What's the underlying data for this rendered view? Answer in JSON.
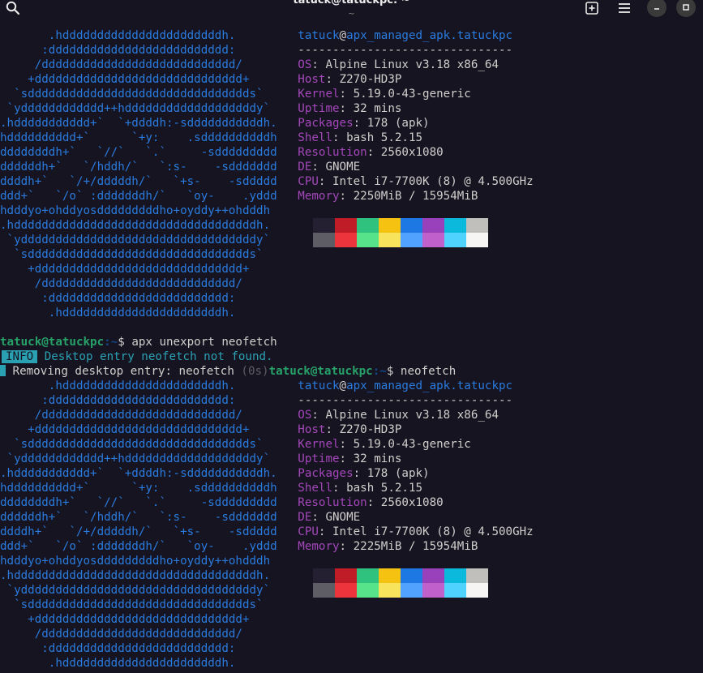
{
  "window": {
    "title": "tatuck@tatuckpc: ~",
    "subtitle": "~"
  },
  "logo_lines": [
    "       .hdddddddddddddddddddddddh.",
    "      :dddddddddddddddddddddddddd:",
    "     /dddddddddddddddddddddddddddd/",
    "    +dddddddddddddddddddddddddddddd+",
    "  `sdddddddddddddddddddddddddddddddds`",
    " `ydddddddddddd++hdddddddddddddddddddy`",
    ".hddddddddddd+`  `+ddddh:-sdddddddddddh.",
    "hdddddddddd+`      `+y:    .sddddddddddh",
    "ddddddddh+`   `//`   `.`     -sddddddddd",
    "ddddddh+`   `/hddh/`   `:s-    -sddddddd",
    "ddddh+`   `/+/dddddh/`   `+s-    -sddddd",
    "ddd+`   `/o` :dddddddh/`   `oy-    .yddd",
    "hdddyo+ohddyosdddddddddho+oyddy++ohdddh",
    ".hdddddddddddddddddddddddddddddddddddh.",
    " `yddddddddddddddddddddddddddddddddddy`",
    "  `sdddddddddddddddddddddddddddddddds`",
    "    +dddddddddddddddddddddddddddddd+",
    "     /dddddddddddddddddddddddddddd/",
    "      :dddddddddddddddddddddddddd:",
    "       .hdddddddddddddddddddddddh."
  ],
  "prompt": {
    "user_host": "tatuck@tatuckpc",
    "path": ":~",
    "symbol": "$"
  },
  "fetch1": {
    "header_user": "tatuck",
    "header_at": "@",
    "header_host": "apx_managed_apk.tatuckpc",
    "separator": "-------------------------------",
    "rows": [
      {
        "key": "OS",
        "value": ": Alpine Linux v3.18 x86_64"
      },
      {
        "key": "Host",
        "value": ": Z270-HD3P"
      },
      {
        "key": "Kernel",
        "value": ": 5.19.0-43-generic"
      },
      {
        "key": "Uptime",
        "value": ": 32 mins"
      },
      {
        "key": "Packages",
        "value": ": 178 (apk)"
      },
      {
        "key": "Shell",
        "value": ": bash 5.2.15"
      },
      {
        "key": "Resolution",
        "value": ": 2560x1080"
      },
      {
        "key": "DE",
        "value": ": GNOME"
      },
      {
        "key": "CPU",
        "value": ": Intel i7-7700K (8) @ 4.500GHz"
      },
      {
        "key": "Memory",
        "value": ": 2250MiB / 15954MiB"
      }
    ]
  },
  "command1": {
    "cmd": "apx unexport neofetch",
    "info_badge": "INFO",
    "info_text": "Desktop entry neofetch not found.",
    "removing_text": "  Removing desktop entry: neofetch ",
    "elapsed": "(0s)"
  },
  "command2": {
    "cmd": "neofetch"
  },
  "fetch2": {
    "header_user": "tatuck",
    "header_at": "@",
    "header_host": "apx_managed_apk.tatuckpc",
    "separator": "-------------------------------",
    "rows": [
      {
        "key": "OS",
        "value": ": Alpine Linux v3.18 x86_64"
      },
      {
        "key": "Host",
        "value": ": Z270-HD3P"
      },
      {
        "key": "Kernel",
        "value": ": 5.19.0-43-generic"
      },
      {
        "key": "Uptime",
        "value": ": 32 mins"
      },
      {
        "key": "Packages",
        "value": ": 178 (apk)"
      },
      {
        "key": "Shell",
        "value": ": bash 5.2.15"
      },
      {
        "key": "Resolution",
        "value": ": 2560x1080"
      },
      {
        "key": "DE",
        "value": ": GNOME"
      },
      {
        "key": "CPU",
        "value": ": Intel i7-7700K (8) @ 4.500GHz"
      },
      {
        "key": "Memory",
        "value": ": 2225MiB / 15954MiB"
      }
    ]
  },
  "palette": {
    "normal": [
      "#241f31",
      "#c01c28",
      "#2ec27e",
      "#f5c211",
      "#1e78e4",
      "#9841bb",
      "#0ab9dc",
      "#c0bfbc"
    ],
    "bright": [
      "#5e5c64",
      "#ed333b",
      "#57e389",
      "#f8e45c",
      "#51a1ff",
      "#c061cb",
      "#4fd2fd",
      "#f6f5f4"
    ]
  },
  "icons": {
    "search": "search-icon",
    "new_tab": "new-tab-icon",
    "menu": "hamburger-menu-icon",
    "minimize": "minimize-icon",
    "maximize": "maximize-icon",
    "close": "close-icon"
  }
}
